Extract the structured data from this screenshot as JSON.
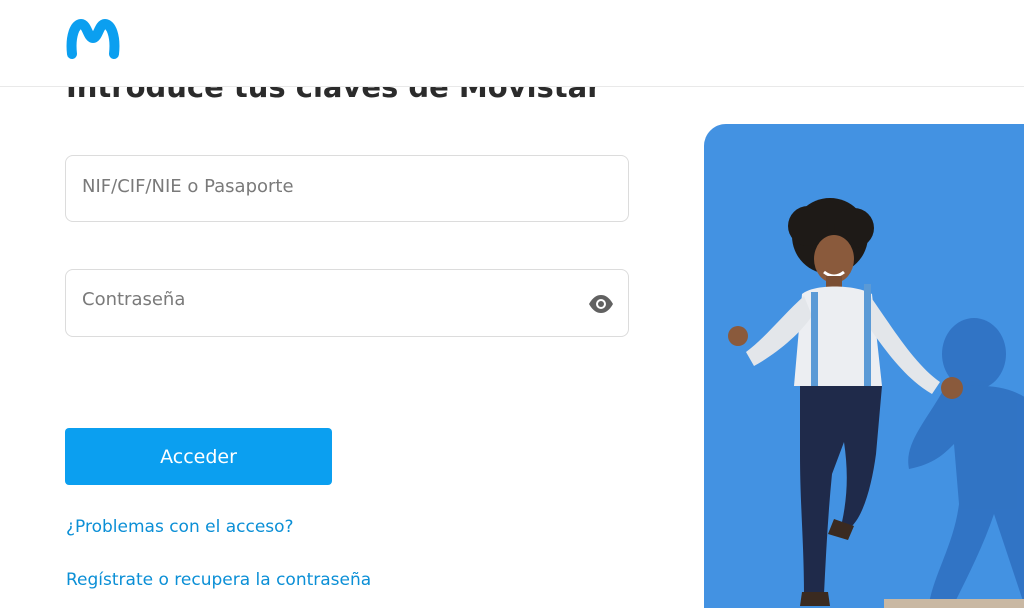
{
  "brand": {
    "logo_icon": "movistar-m-logo-icon",
    "color": "#0b9ff0"
  },
  "login": {
    "title": "Introduce tus claves de Movistar",
    "id_field": {
      "placeholder": "NIF/CIF/NIE o Pasaporte",
      "value": ""
    },
    "password_field": {
      "placeholder": "Contraseña",
      "value": "",
      "toggle_icon": "eye-icon"
    },
    "submit_label": "Acceder",
    "link_problems": "¿Problemas con el acceso?",
    "link_register": "Regístrate o recupera la contraseña"
  },
  "colors": {
    "accent": "#0b9ff0",
    "link": "#0b8fd6",
    "hero_background": "#3f8fe0"
  }
}
